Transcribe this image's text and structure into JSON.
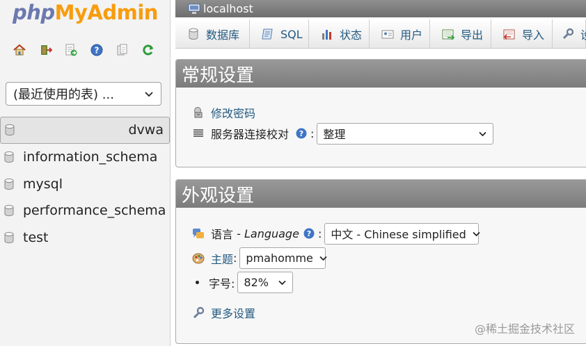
{
  "logo": {
    "part1": "php",
    "part2": "MyAdmin"
  },
  "nav": {
    "icons": [
      "home-icon",
      "exit-icon",
      "sql-query-icon",
      "help-icon",
      "docs-icon",
      "reload-icon"
    ],
    "recent_tables": "(最近使用的表) ...",
    "databases": [
      "dvwa",
      "information_schema",
      "mysql",
      "performance_schema",
      "test"
    ],
    "selected_database": "dvwa"
  },
  "server": {
    "name": "localhost"
  },
  "menu": {
    "tabs": [
      {
        "label": "数据库",
        "icon": "database-icon"
      },
      {
        "label": "SQL",
        "icon": "sql-icon"
      },
      {
        "label": "状态",
        "icon": "status-icon"
      },
      {
        "label": "用户",
        "icon": "users-icon"
      },
      {
        "label": "导出",
        "icon": "export-icon"
      },
      {
        "label": "导入",
        "icon": "import-icon"
      },
      {
        "label": "设",
        "icon": "settings-icon"
      }
    ]
  },
  "general": {
    "title": "常规设置",
    "change_password": "修改密码",
    "collation_label": "服务器连接校对",
    "colon": ":",
    "collation_value": "整理"
  },
  "appearance": {
    "title": "外观设置",
    "language_label": "语言",
    "language_sep": " - ",
    "language_en": "Language",
    "colon": ":",
    "language_value": "中文 - Chinese simplified",
    "theme_label": "主题",
    "theme_colon": ":",
    "theme_value": "pmahomme",
    "fontsize_label": "字号:",
    "fontsize_value": "82%",
    "more_settings": "更多设置"
  },
  "watermark": "@稀土掘金技术社区",
  "colors": {
    "link": "#235a81",
    "logo_php": "#6c78af",
    "logo_admin": "#f89c0e",
    "panel_header": "#888888"
  }
}
